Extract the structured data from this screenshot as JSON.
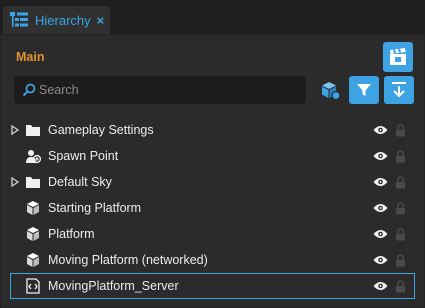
{
  "tab": {
    "title": "Hierarchy",
    "close_symbol": "×",
    "icon": "hierarchy-icon"
  },
  "panel": {
    "section_label": "Main",
    "search": {
      "placeholder": "Search",
      "value": ""
    }
  },
  "colors": {
    "accent": "#3ea3e2",
    "section_label": "#e3932d",
    "background": "#2b2b2b",
    "tabbar": "#1f1f1f"
  },
  "tree": [
    {
      "label": "Gameplay Settings",
      "icon": "folder-icon",
      "expandable": true,
      "selected": false
    },
    {
      "label": "Spawn Point",
      "icon": "spawn-point-icon",
      "expandable": false,
      "selected": false
    },
    {
      "label": "Default Sky",
      "icon": "folder-icon",
      "expandable": true,
      "selected": false
    },
    {
      "label": "Starting Platform",
      "icon": "cube-icon",
      "expandable": false,
      "selected": false
    },
    {
      "label": "Platform",
      "icon": "cube-icon",
      "expandable": false,
      "selected": false
    },
    {
      "label": "Moving Platform (networked)",
      "icon": "cube-icon",
      "expandable": false,
      "selected": false
    },
    {
      "label": "MovingPlatform_Server",
      "icon": "script-icon",
      "expandable": false,
      "selected": true
    }
  ]
}
